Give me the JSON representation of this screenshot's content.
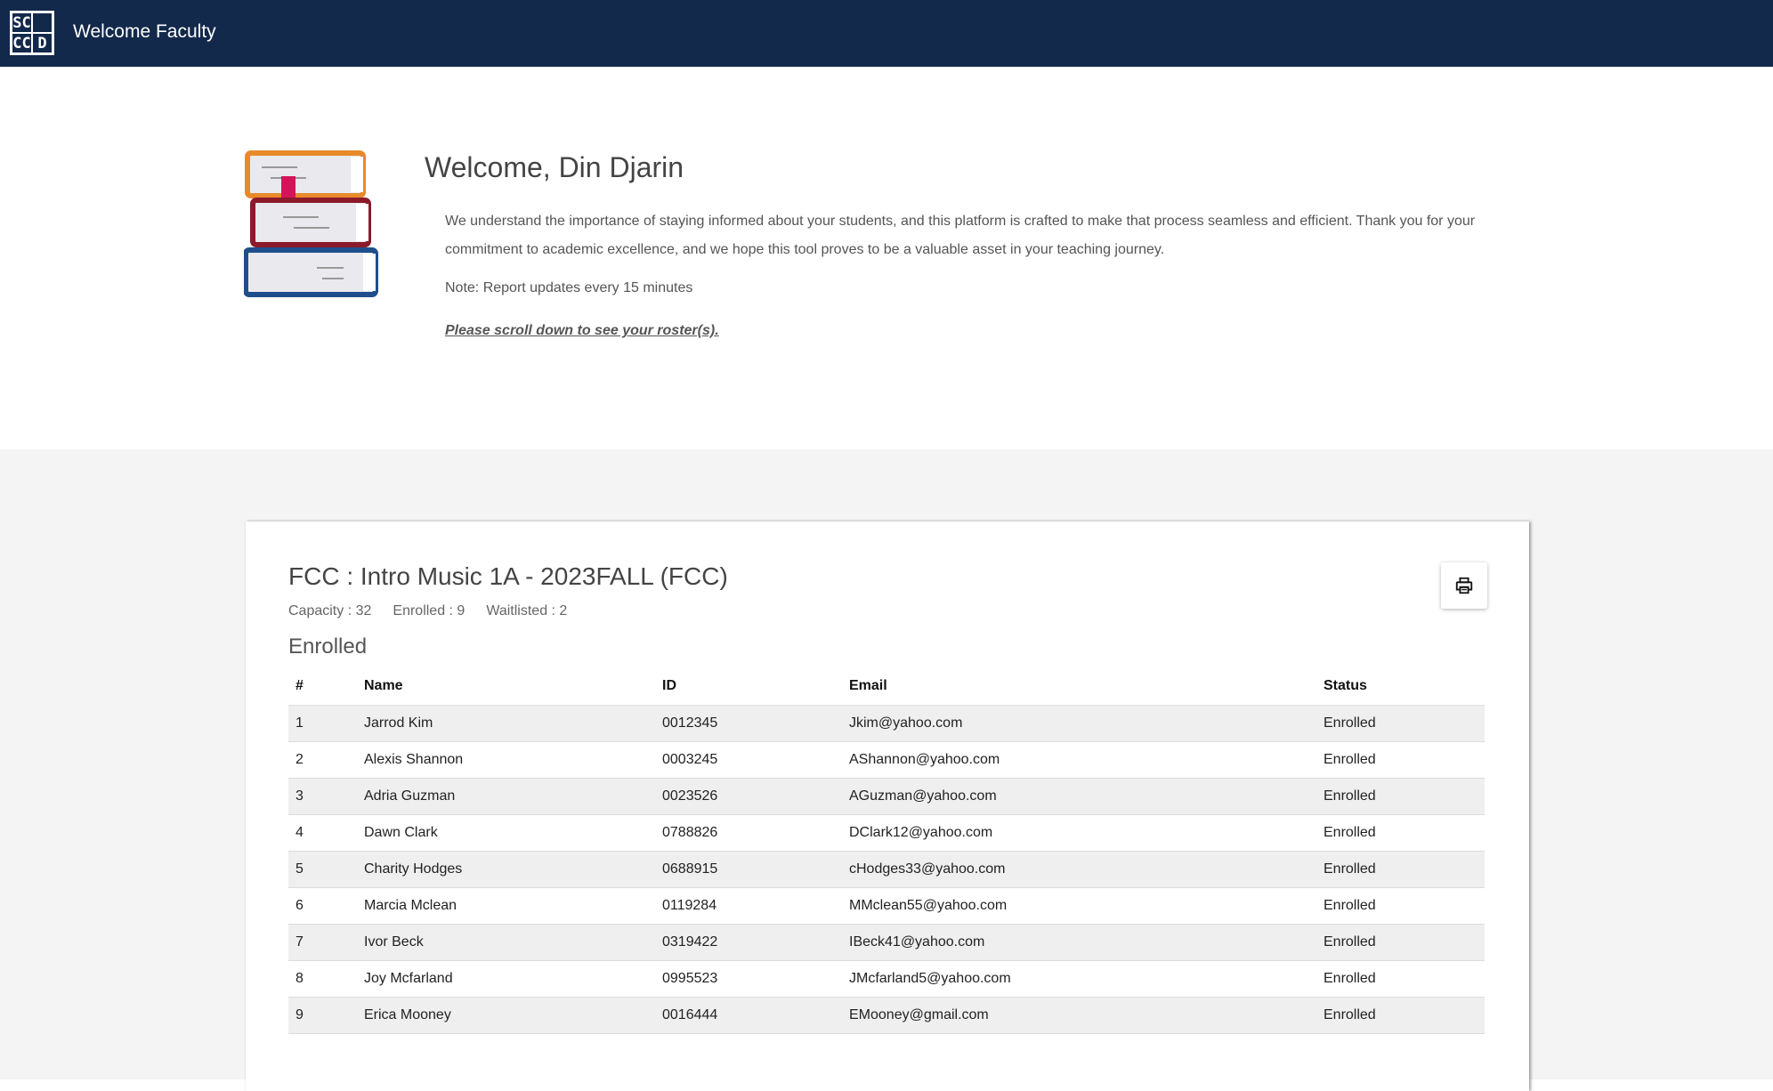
{
  "header": {
    "logo_letters": [
      "SC",
      "",
      "CC",
      "D"
    ],
    "title": "Welcome Faculty"
  },
  "welcome": {
    "title": "Welcome, Din Djarin",
    "message": "We understand the importance of staying informed about your students, and this platform is crafted to make that process seamless and efficient. Thank you for your commitment to academic excellence, and we hope this tool proves to be a valuable asset in your teaching journey.",
    "note": "Note: Report updates every 15 minutes",
    "scroll_link": "Please scroll down to see your roster(s)."
  },
  "course": {
    "title": "FCC : Intro Music 1A - 2023FALL (FCC)",
    "capacity": "Capacity : 32",
    "enrolled": "Enrolled : 9",
    "waitlisted": "Waitlisted : 2",
    "section_title": "Enrolled",
    "columns": [
      "#",
      "Name",
      "ID",
      "Email",
      "Status"
    ],
    "rows": [
      {
        "num": "1",
        "name": "Jarrod Kim",
        "id": "0012345",
        "email": "Jkim@yahoo.com",
        "status": "Enrolled"
      },
      {
        "num": "2",
        "name": "Alexis Shannon",
        "id": "0003245",
        "email": "AShannon@yahoo.com",
        "status": "Enrolled"
      },
      {
        "num": "3",
        "name": "Adria Guzman",
        "id": "0023526",
        "email": "AGuzman@yahoo.com",
        "status": "Enrolled"
      },
      {
        "num": "4",
        "name": "Dawn Clark",
        "id": "0788826",
        "email": "DClark12@yahoo.com",
        "status": "Enrolled"
      },
      {
        "num": "5",
        "name": "Charity Hodges",
        "id": "0688915",
        "email": "cHodges33@yahoo.com",
        "status": "Enrolled"
      },
      {
        "num": "6",
        "name": "Marcia Mclean",
        "id": "0119284",
        "email": "MMclean55@yahoo.com",
        "status": "Enrolled"
      },
      {
        "num": "7",
        "name": "Ivor Beck",
        "id": "0319422",
        "email": "IBeck41@yahoo.com",
        "status": "Enrolled"
      },
      {
        "num": "8",
        "name": "Joy Mcfarland",
        "id": "0995523",
        "email": "JMcfarland5@yahoo.com",
        "status": "Enrolled"
      },
      {
        "num": "9",
        "name": "Erica Mooney",
        "id": "0016444",
        "email": "EMooney@gmail.com",
        "status": "Enrolled"
      }
    ]
  },
  "icons": {
    "print": "printer-icon",
    "books": "books-icon"
  },
  "colors": {
    "header_bg": "#13294b",
    "band_bg": "#f4f4f4",
    "row_stripe": "#efefef",
    "book_orange": "#e8892a",
    "book_maroon": "#8b1a2b",
    "book_blue": "#1f4e8c",
    "bookmark": "#d4145a"
  }
}
